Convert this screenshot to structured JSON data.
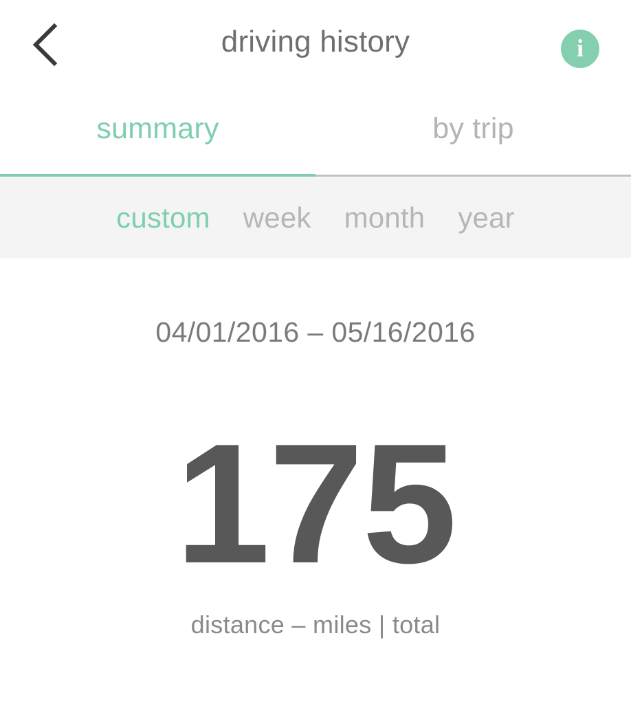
{
  "header": {
    "title": "driving history",
    "back_icon": "chevron-left-icon",
    "info_icon": "info-icon",
    "info_glyph": "i",
    "accent_color": "#84cfb0",
    "title_color": "#6f6f6f"
  },
  "tabs": {
    "items": [
      {
        "label": "summary",
        "active": true
      },
      {
        "label": "by trip",
        "active": false
      }
    ],
    "active_color": "#7ecfae",
    "inactive_color": "#b4b4b4",
    "underline_active_color": "#7ecfae",
    "underline_inactive_color": "#c0c0c0"
  },
  "filters": {
    "items": [
      {
        "label": "custom",
        "active": true
      },
      {
        "label": "week",
        "active": false
      },
      {
        "label": "month",
        "active": false
      },
      {
        "label": "year",
        "active": false
      }
    ],
    "background_color": "#f4f4f4",
    "active_color": "#7ecfae",
    "inactive_color": "#b6b6b6"
  },
  "summary": {
    "date_range": "04/01/2016 – 05/16/2016",
    "metric_value": "175",
    "metric_caption": "distance – miles | total",
    "metric_color": "#585858"
  }
}
